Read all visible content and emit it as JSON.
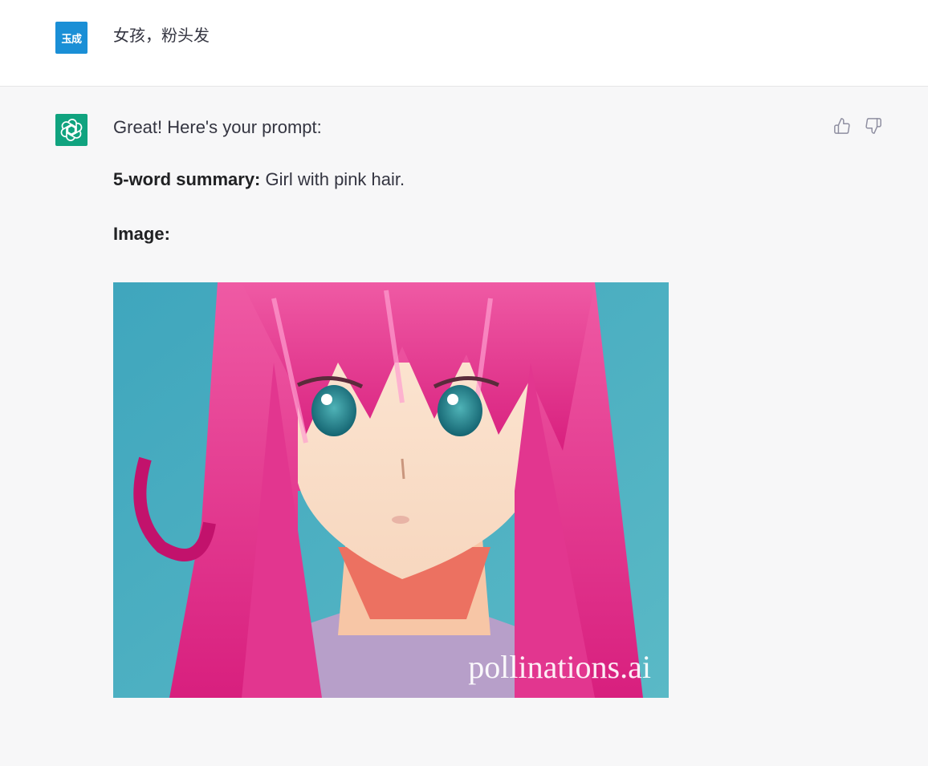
{
  "user_message": {
    "avatar_text": "玉成",
    "text": "女孩，粉头发",
    "avatar_color": "#1a8fd6"
  },
  "assistant_message": {
    "avatar_icon": "openai-logo-icon",
    "avatar_color": "#10a37f",
    "intro": "Great! Here's your prompt:",
    "summary_label": "5-word summary:",
    "summary_text": " Girl with pink hair.",
    "image_label": "Image:",
    "image_watermark": "pollinations.ai",
    "image_subject": "anime girl with pink hair on teal background"
  },
  "feedback": {
    "thumbs_up_icon": "thumbs-up-icon",
    "thumbs_down_icon": "thumbs-down-icon"
  }
}
